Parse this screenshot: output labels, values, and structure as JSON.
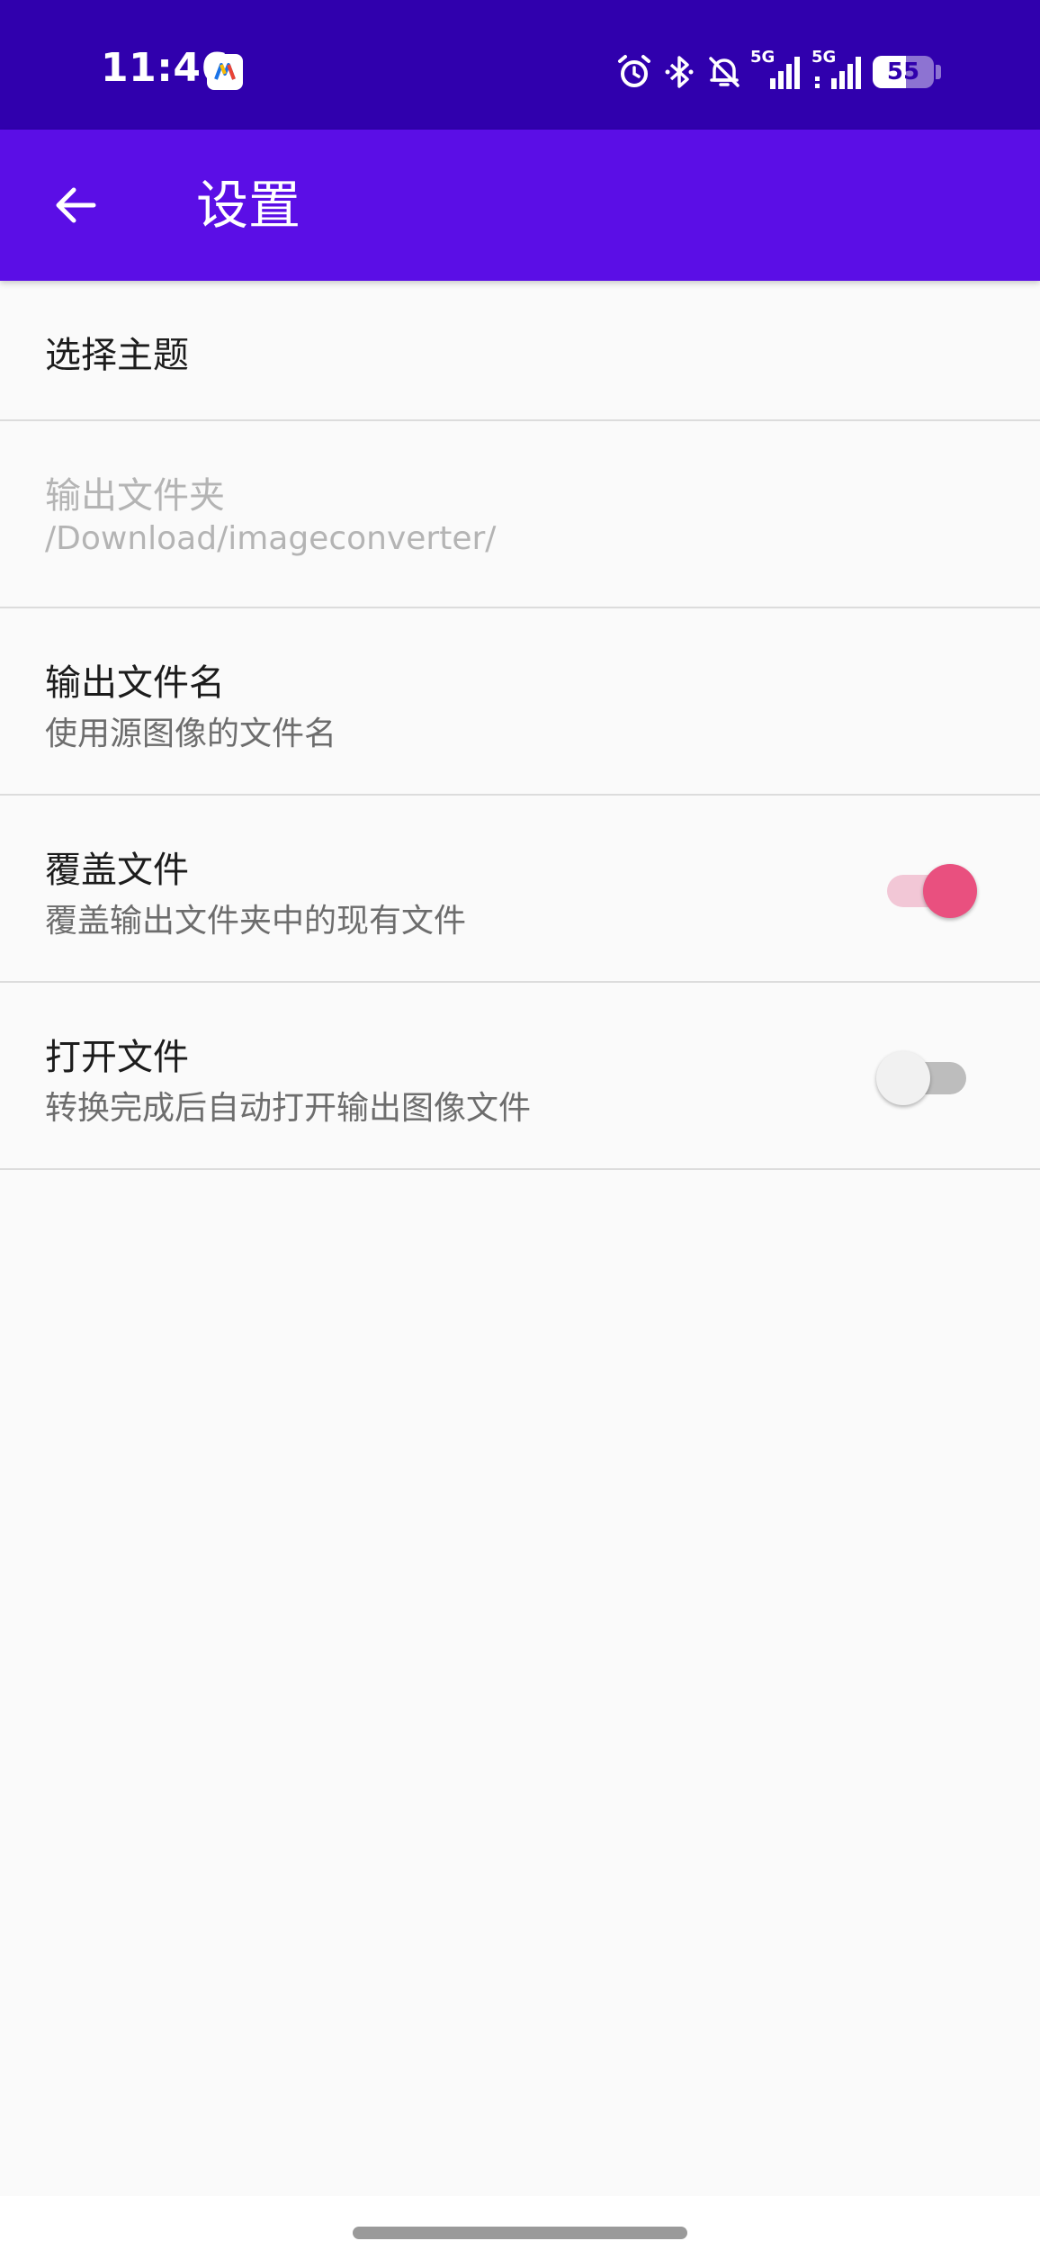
{
  "status_bar": {
    "time": "11:46",
    "signal_1_label": "5G",
    "signal_2_label": "5G",
    "battery_level": "55",
    "battery_fraction": 0.55,
    "icons": [
      "app-notification-icon",
      "alarm-icon",
      "bluetooth-icon",
      "bell-off-icon",
      "signal-icon",
      "battery-icon"
    ]
  },
  "app_bar": {
    "title": "设置",
    "back_icon": "arrow-left-icon"
  },
  "colors": {
    "status_bar_bg": "#3000ad",
    "app_bar_bg": "#5b0ee6",
    "switch_on_thumb": "#e9507f",
    "switch_on_track": "#f2c7d6",
    "switch_off_thumb": "#f1f1f1",
    "switch_off_track": "#bdbdbd"
  },
  "settings": {
    "theme": {
      "title": "选择主题"
    },
    "output_folder": {
      "title": "输出文件夹",
      "summary": "/Download/imageconverter/",
      "enabled": false
    },
    "output_filename": {
      "title": "输出文件名",
      "summary": "使用源图像的文件名"
    },
    "overwrite": {
      "title": "覆盖文件",
      "summary": "覆盖输出文件夹中的现有文件",
      "checked": true
    },
    "open_file": {
      "title": "打开文件",
      "summary": "转换完成后自动打开输出图像文件",
      "checked": false
    }
  }
}
